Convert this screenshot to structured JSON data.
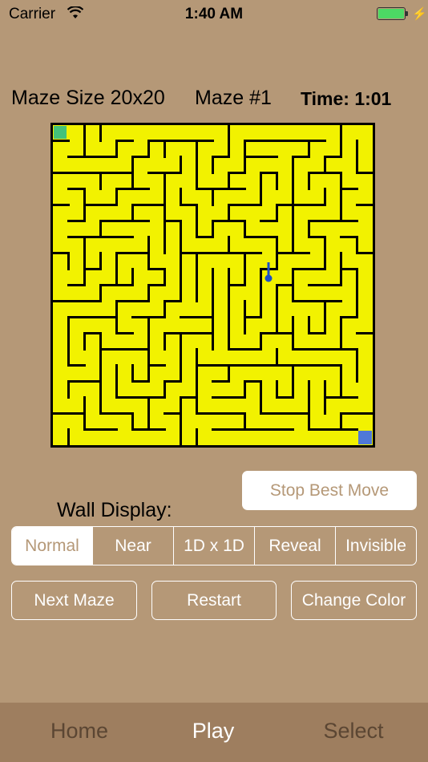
{
  "status_bar": {
    "carrier": "Carrier",
    "time": "1:40 AM"
  },
  "header": {
    "maze_size": "Maze Size 20x20",
    "maze_number": "Maze #1",
    "time": "Time: 1:01"
  },
  "colors": {
    "background": "#b59877",
    "maze_floor": "#f2f200",
    "start_cell": "#44c27a",
    "end_cell": "#4f78d8",
    "player": "#1a4fc8",
    "tab_bar": "#9e7e5f"
  },
  "stop_best_move_label": "Stop Best Move",
  "wall_display": {
    "label": "Wall Display:",
    "options": [
      "Normal",
      "Near",
      "1D x 1D",
      "Reveal",
      "Invisible"
    ],
    "selected": "Normal"
  },
  "buttons": {
    "next_maze": "Next Maze",
    "restart": "Restart",
    "change_color": "Change Color"
  },
  "tabs": [
    {
      "label": "Home",
      "active": false
    },
    {
      "label": "Play",
      "active": true
    },
    {
      "label": "Select",
      "active": false
    }
  ]
}
